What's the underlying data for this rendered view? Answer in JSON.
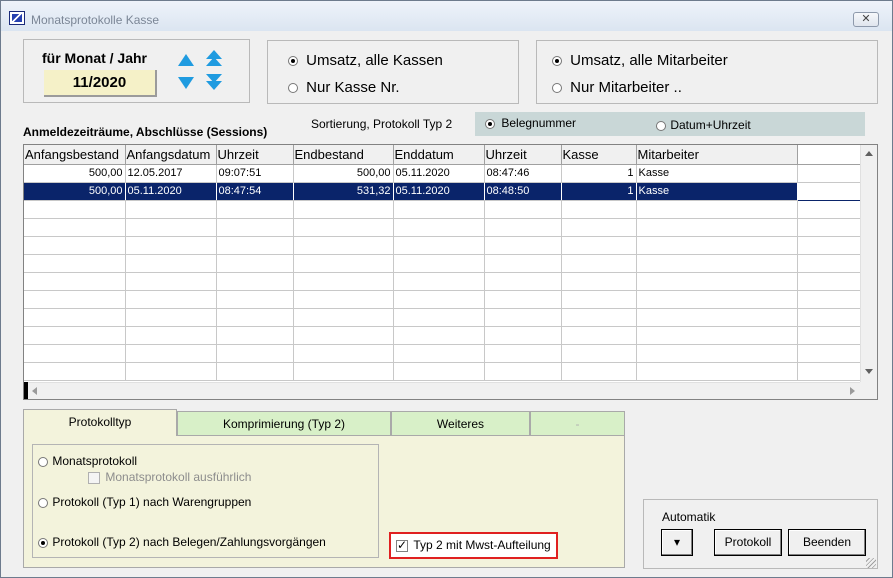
{
  "window": {
    "title": "Monatsprotokolle Kasse",
    "close_glyph": "✕"
  },
  "period": {
    "label": "für Monat / Jahr",
    "value": "11/2020"
  },
  "kassen": {
    "opt1": "Umsatz, alle Kassen",
    "opt2": "Nur Kasse Nr.",
    "selected": 1
  },
  "mitarbeiter": {
    "opt1": "Umsatz, alle Mitarbeiter",
    "opt2": "Nur Mitarbeiter ..",
    "selected": 1
  },
  "sessions": {
    "label": "Anmeldezeiträume, Abschlüsse (Sessions)"
  },
  "sort": {
    "label": "Sortierung, Protokoll Typ 2",
    "opt1": "Belegnummer",
    "opt2": "Datum+Uhrzeit",
    "selected": 1
  },
  "table": {
    "columns": [
      "Anfangsbestand",
      "Anfangsdatum",
      "Uhrzeit",
      "Endbestand",
      "Enddatum",
      "Uhrzeit",
      "Kasse",
      "Mitarbeiter"
    ],
    "rows": [
      [
        "500,00",
        "12.05.2017",
        "09:07:51",
        "500,00",
        "05.11.2020",
        "08:47:46",
        "1",
        "Kasse"
      ],
      [
        "500,00",
        "05.11.2020",
        "08:47:54",
        "531,32",
        "05.11.2020",
        "08:48:50",
        "1",
        "Kasse"
      ]
    ],
    "selected_row": 2
  },
  "tabs": [
    "Protokolltyp",
    "Komprimierung (Typ 2)",
    "Weiteres",
    "-"
  ],
  "protokoll": {
    "opt1": "Monatsprotokoll",
    "opt1_sub": "Monatsprotokoll ausführlich",
    "opt2": "Protokoll (Typ 1) nach Warengruppen",
    "opt3": "Protokoll (Typ 2) nach Belegen/Zahlungsvorgängen",
    "selected": 3
  },
  "mwst": {
    "label": "Typ 2 mit Mwst-Aufteilung",
    "checked": true
  },
  "automatik": {
    "label": "Automatik",
    "dropdown": "▾",
    "protokoll": "Protokoll",
    "beenden": "Beenden"
  },
  "colors": {
    "selection": "#0a246a",
    "arrows": "#1f9be0",
    "tab_active": "#f3f3dc",
    "tab_inactive": "#d8f0c8",
    "highlight_border": "#e02020"
  }
}
